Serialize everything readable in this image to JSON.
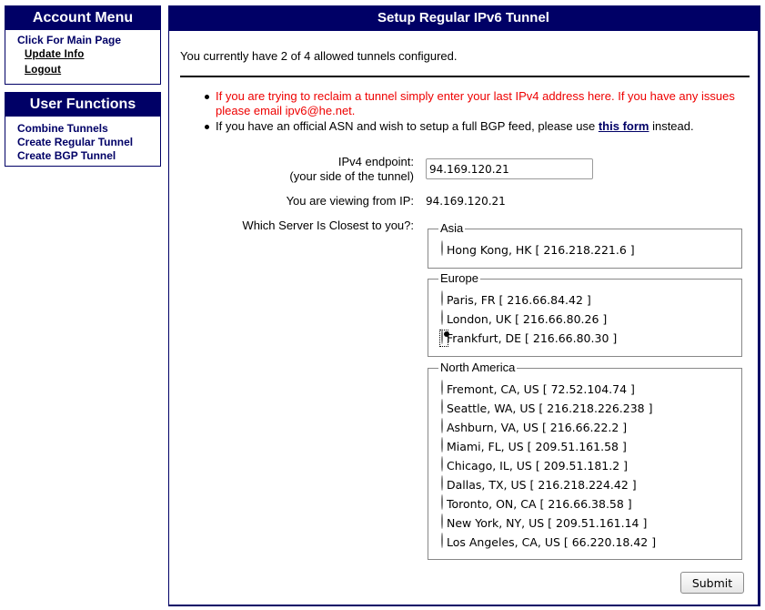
{
  "sidebar": {
    "account_menu": {
      "title": "Account Menu",
      "main_page_link": "Click For Main Page",
      "items": [
        {
          "label": "Update Info"
        },
        {
          "label": "Logout"
        }
      ]
    },
    "user_functions": {
      "title": "User Functions",
      "items": [
        {
          "label": "Combine Tunnels"
        },
        {
          "label": "Create Regular Tunnel"
        },
        {
          "label": "Create BGP Tunnel"
        }
      ]
    }
  },
  "main": {
    "title": "Setup Regular IPv6 Tunnel",
    "intro": "You currently have 2 of 4 allowed tunnels configured.",
    "notes": {
      "reclaim": "If you are trying to reclaim a tunnel simply enter your last IPv4 address here. If you have any issues please email ipv6@he.net.",
      "bgp_prefix": "If you have an official ASN and wish to setup a full BGP feed, please use ",
      "bgp_link": "this form",
      "bgp_suffix": " instead."
    },
    "form": {
      "ipv4_label_line1": "IPv4 endpoint:",
      "ipv4_label_line2": "(your side of the tunnel)",
      "ipv4_value": "94.169.120.21",
      "viewing_label": "You are viewing from IP:",
      "viewing_ip": "94.169.120.21",
      "server_label": "Which Server Is Closest to you?:",
      "selected_server": "Frankfurt, DE [ 216.66.80.30 ]",
      "regions": [
        {
          "name": "Asia",
          "servers": [
            {
              "label": "Hong Kong, HK [ 216.218.221.6 ]",
              "checked": false
            }
          ]
        },
        {
          "name": "Europe",
          "servers": [
            {
              "label": "Paris, FR [ 216.66.84.42 ]",
              "checked": false
            },
            {
              "label": "London, UK [ 216.66.80.26 ]",
              "checked": false
            },
            {
              "label": "Frankfurt, DE [ 216.66.80.30 ]",
              "checked": true
            }
          ]
        },
        {
          "name": "North America",
          "servers": [
            {
              "label": "Fremont, CA, US [ 72.52.104.74 ]",
              "checked": false
            },
            {
              "label": "Seattle, WA, US [ 216.218.226.238 ]",
              "checked": false
            },
            {
              "label": "Ashburn, VA, US [ 216.66.22.2 ]",
              "checked": false
            },
            {
              "label": "Miami, FL, US [ 209.51.161.58 ]",
              "checked": false
            },
            {
              "label": "Chicago, IL, US [ 209.51.181.2 ]",
              "checked": false
            },
            {
              "label": "Dallas, TX, US [ 216.218.224.42 ]",
              "checked": false
            },
            {
              "label": "Toronto, ON, CA [ 216.66.38.58 ]",
              "checked": false
            },
            {
              "label": "New York, NY, US [ 209.51.161.14 ]",
              "checked": false
            },
            {
              "label": "Los Angeles, CA, US [ 66.220.18.42 ]",
              "checked": false
            }
          ]
        }
      ],
      "submit_label": "Submit"
    }
  },
  "colors": {
    "header_bg": "#000066",
    "link": "#000066",
    "warning_text": "#ee0000"
  }
}
